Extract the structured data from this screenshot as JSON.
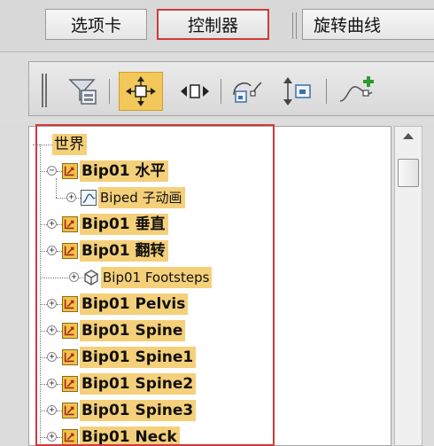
{
  "tabs": {
    "tab1_label": "选项卡",
    "tab2_label": "控制器",
    "tab3_label": "旋转曲线"
  },
  "toolbar": {
    "buttons": [
      {
        "icon": "filter-icon"
      },
      {
        "icon": "move-icon",
        "active": true
      },
      {
        "icon": "horizontal-arrows-icon"
      },
      {
        "icon": "curve-frame-icon"
      },
      {
        "icon": "vertical-arrow-frame-icon"
      },
      {
        "icon": "curve-add-icon"
      }
    ]
  },
  "tree": {
    "rows": [
      {
        "label": "世界",
        "icon": "none"
      },
      {
        "label": "Bip01 水平",
        "icon": "bone-icon",
        "expander": "−"
      },
      {
        "label": "Biped 子动画",
        "icon": "curve-icon",
        "expander": "+"
      },
      {
        "label": "Bip01 垂直",
        "icon": "bone-icon",
        "expander": "+"
      },
      {
        "label": "Bip01 翻转",
        "icon": "bone-icon",
        "expander": "+"
      },
      {
        "label": "Bip01 Footsteps",
        "icon": "footsteps-icon",
        "expander": "+"
      },
      {
        "label": "Bip01 Pelvis",
        "icon": "bone-icon",
        "expander": "+"
      },
      {
        "label": "Bip01 Spine",
        "icon": "bone-icon",
        "expander": "+"
      },
      {
        "label": "Bip01 Spine1",
        "icon": "bone-icon",
        "expander": "+"
      },
      {
        "label": "Bip01 Spine2",
        "icon": "bone-icon",
        "expander": "+"
      },
      {
        "label": "Bip01 Spine3",
        "icon": "bone-icon",
        "expander": "+"
      },
      {
        "label": "Bip01 Neck",
        "icon": "bone-icon",
        "expander": "+"
      }
    ]
  },
  "colors": {
    "highlight": "#f5d07a",
    "selection_border": "#d03a3a",
    "active_button": "#f3c85a"
  }
}
